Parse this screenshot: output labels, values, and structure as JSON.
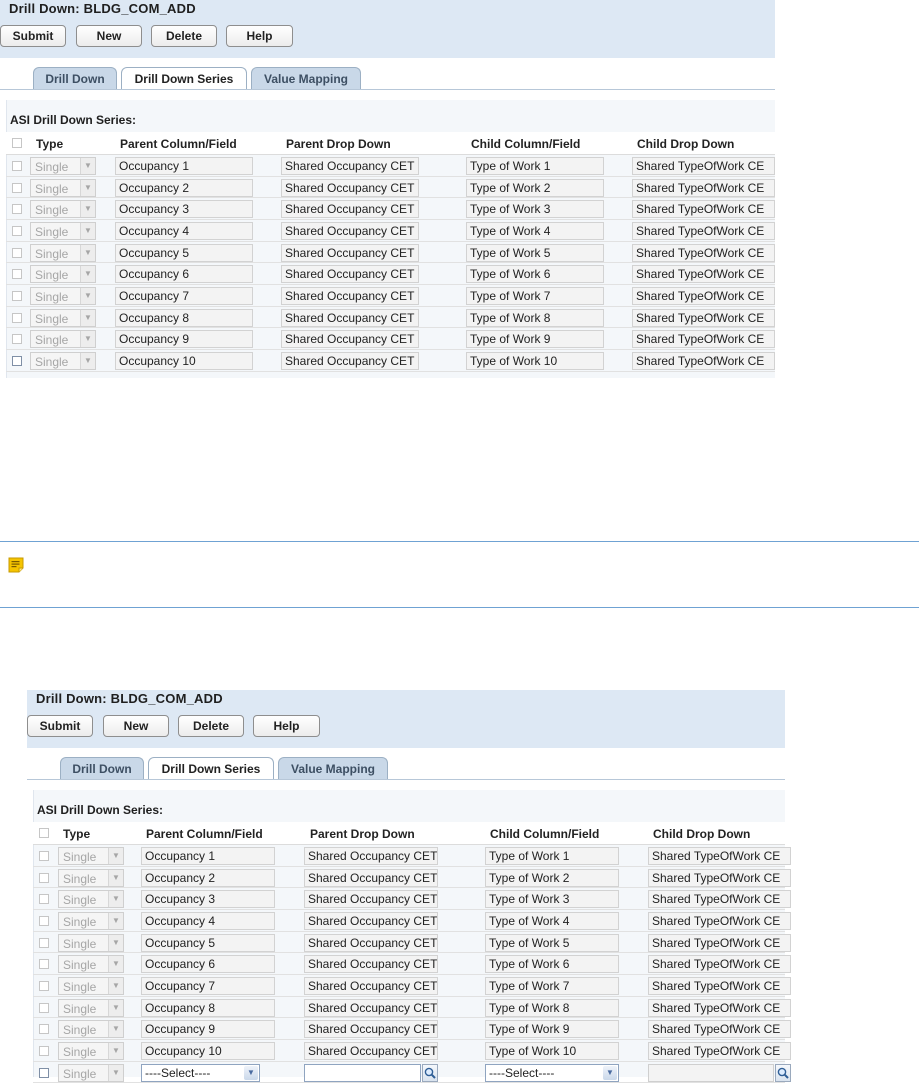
{
  "title": "Drill Down: BLDG_COM_ADD",
  "toolbar": {
    "submit": "Submit",
    "new": "New",
    "delete": "Delete",
    "help": "Help"
  },
  "tabs": {
    "drill_down": "Drill Down",
    "drill_down_series": "Drill Down Series",
    "value_mapping": "Value Mapping"
  },
  "section_title": "ASI Drill Down Series:",
  "columns": {
    "type": "Type",
    "parent_column": "Parent Column/Field",
    "parent_drop_down": "Parent Drop Down",
    "child_column": "Child Column/Field",
    "child_drop_down": "Child Drop Down"
  },
  "type_value": "Single",
  "parent_columns": [
    "Occupancy 1",
    "Occupancy 2",
    "Occupancy 3",
    "Occupancy 4",
    "Occupancy 5",
    "Occupancy 6",
    "Occupancy 7",
    "Occupancy 8",
    "Occupancy 9",
    "Occupancy 10"
  ],
  "parent_drop_down_value": "Shared Occupancy CET",
  "child_columns": [
    "Type of Work 1",
    "Type of Work 2",
    "Type of Work 3",
    "Type of Work 4",
    "Type of Work 5",
    "Type of Work 6",
    "Type of Work 7",
    "Type of Work 8",
    "Type of Work 9",
    "Type of Work 10"
  ],
  "child_drop_down_value": "Shared TypeOfWork CE",
  "new_row": {
    "type": "Single",
    "parent_select": "----Select----",
    "child_select": "----Select----"
  },
  "icons": {
    "note": "note-icon",
    "lookup": "magnifier-icon",
    "dropdown": "chevron-down-icon"
  },
  "colors": {
    "header_band": "#dde8f4",
    "tab_inactive": "#c9d8e8",
    "note_rule": "#6fa2d3",
    "note_icon": "#f5c400"
  }
}
